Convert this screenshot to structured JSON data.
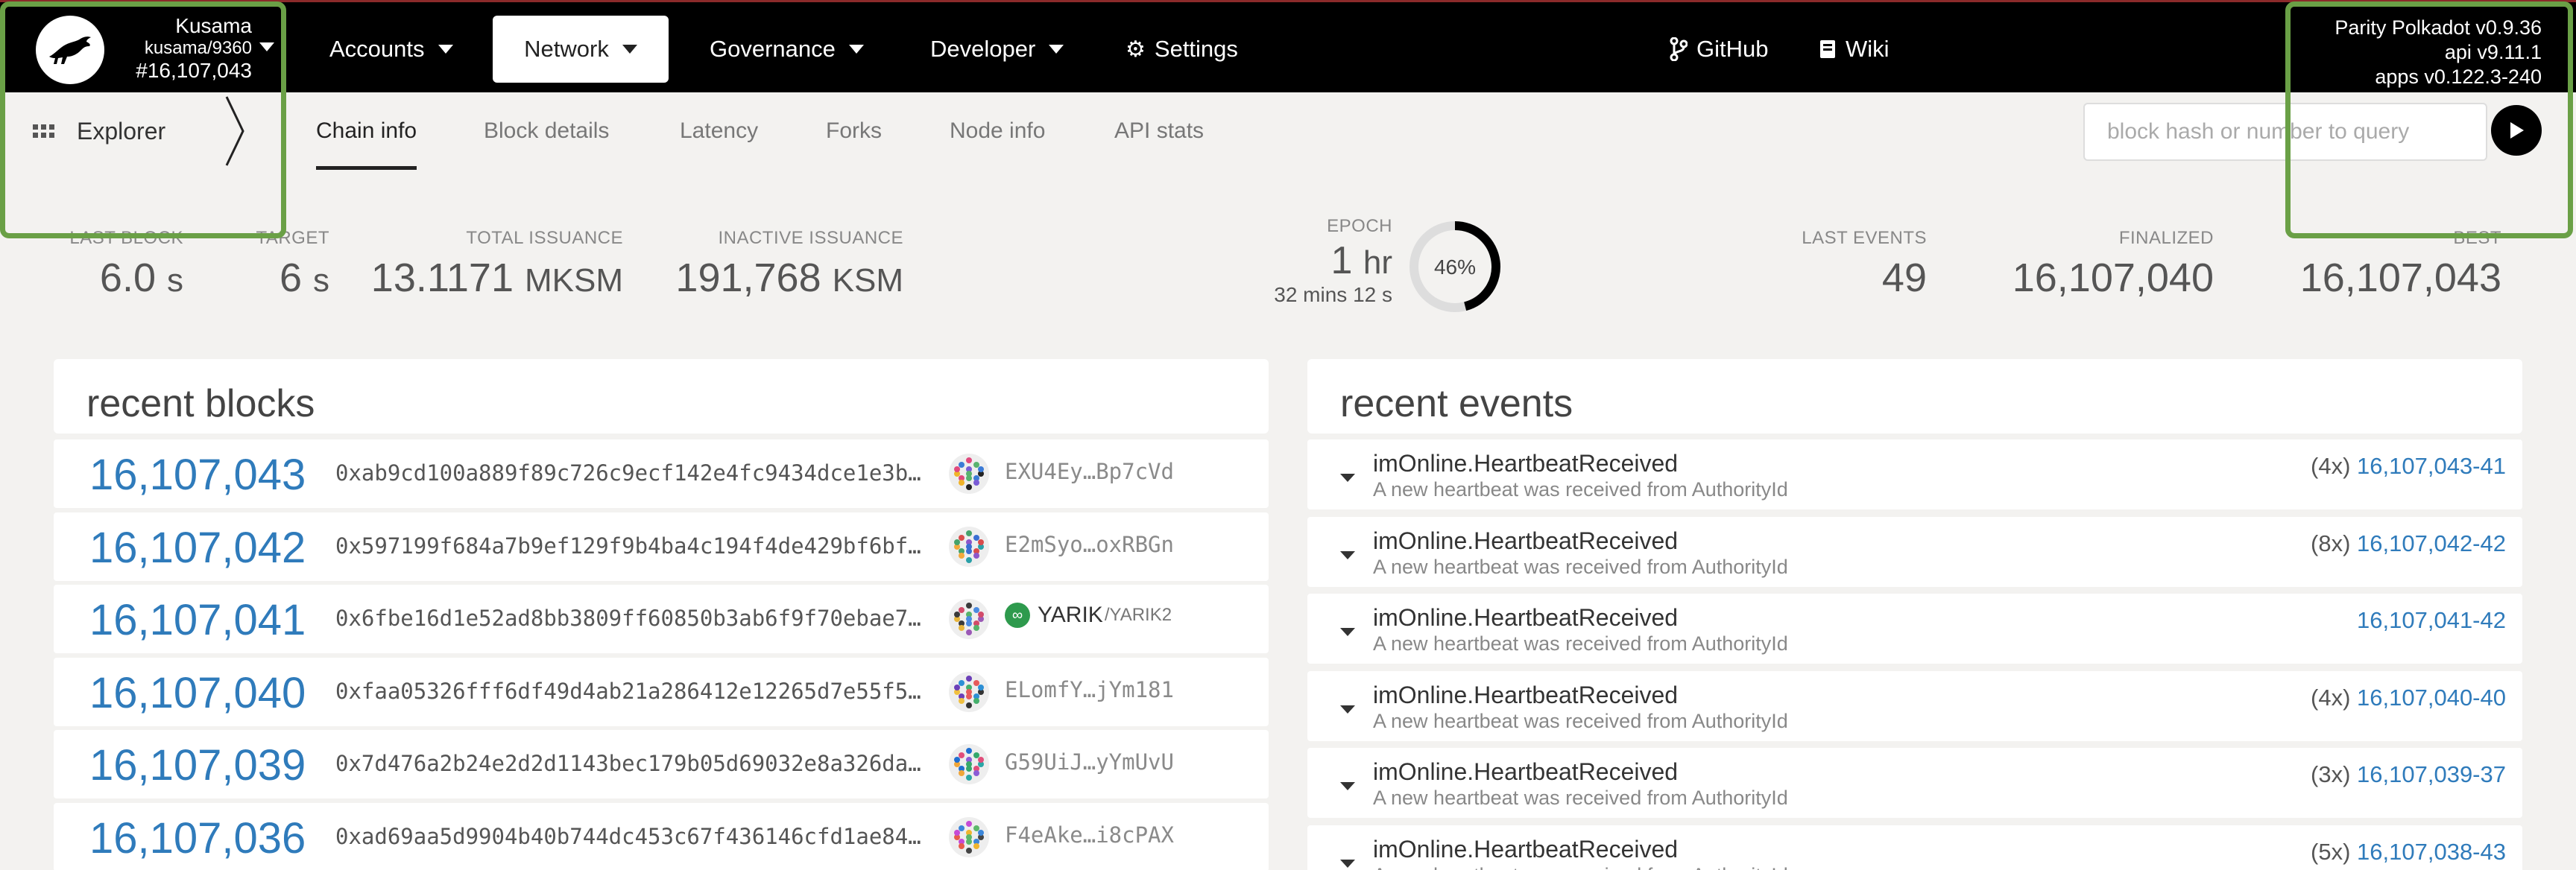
{
  "chain": {
    "name": "Kusama",
    "spec": "kusama/9360",
    "best_block": "#16,107,043"
  },
  "nav": {
    "accounts": "Accounts",
    "network": "Network",
    "governance": "Governance",
    "developer": "Developer",
    "settings": "Settings",
    "github": "GitHub",
    "wiki": "Wiki"
  },
  "version": {
    "node": "Parity Polkadot v0.9.36",
    "api": "api v9.11.1",
    "apps": "apps v0.122.3-240"
  },
  "explorer": {
    "label": "Explorer",
    "tabs": [
      "Chain info",
      "Block details",
      "Latency",
      "Forks",
      "Node info",
      "API stats"
    ]
  },
  "query": {
    "placeholder": "block hash or number to query"
  },
  "stats": {
    "last_block_label": "LAST BLOCK",
    "last_block_value": "6.0",
    "last_block_unit": "s",
    "target_label": "TARGET",
    "target_value": "6",
    "target_unit": "s",
    "total_issuance_label": "TOTAL ISSUANCE",
    "total_issuance_value": "13.1171",
    "total_issuance_unit": "MKSM",
    "inactive_issuance_label": "INACTIVE ISSUANCE",
    "inactive_issuance_value": "191,768",
    "inactive_issuance_unit": "KSM",
    "epoch_label": "EPOCH",
    "epoch_value": "1",
    "epoch_unit": "hr",
    "epoch_sub": "32 mins 12 s",
    "epoch_percent_label": "46%",
    "epoch_progress": 0.46,
    "last_events_label": "LAST EVENTS",
    "last_events_value": "49",
    "finalized_label": "FINALIZED",
    "finalized_value": "16,107,040",
    "best_label": "BEST",
    "best_value": "16,107,043"
  },
  "recent_blocks": {
    "title": "recent blocks",
    "rows": [
      {
        "number": "16,107,043",
        "hash": "0xab9cd100a889f89c726c9ecf142e4fc9434dce1e3b…",
        "author": "EXU4Ey…Bp7cVd"
      },
      {
        "number": "16,107,042",
        "hash": "0x597199f684a7b9ef129f9b4ba4c194f4de429bf6bf…",
        "author": "E2mSyo…oxRBGn"
      },
      {
        "number": "16,107,041",
        "hash": "0x6fbe16d1e52ad8bb3809ff60850b3ab6f9f70ebae7…",
        "author": "YARIK",
        "author_sub": "/YARIK2"
      },
      {
        "number": "16,107,040",
        "hash": "0xfaa05326fff6df49d4ab21a286412e12265d7e55f5…",
        "author": "ELomfY…jYm181"
      },
      {
        "number": "16,107,039",
        "hash": "0x7d476a2b24e2d2d1143bec179b05d69032e8a326da…",
        "author": "G59UiJ…yYmUvU"
      },
      {
        "number": "16,107,036",
        "hash": "0xad69aa5d9904b40b744dc453c67f436146cfd1ae84…",
        "author": "F4eAke…i8cPAX"
      }
    ]
  },
  "recent_events": {
    "title": "recent events",
    "rows": [
      {
        "name": "imOnline.HeartbeatReceived",
        "desc": "A new heartbeat was received from AuthorityId",
        "count": "(4x)",
        "ref": "16,107,043-41"
      },
      {
        "name": "imOnline.HeartbeatReceived",
        "desc": "A new heartbeat was received from AuthorityId",
        "count": "(8x)",
        "ref": "16,107,042-42"
      },
      {
        "name": "imOnline.HeartbeatReceived",
        "desc": "A new heartbeat was received from AuthorityId",
        "count": "",
        "ref": "16,107,041-42"
      },
      {
        "name": "imOnline.HeartbeatReceived",
        "desc": "A new heartbeat was received from AuthorityId",
        "count": "(4x)",
        "ref": "16,107,040-40"
      },
      {
        "name": "imOnline.HeartbeatReceived",
        "desc": "A new heartbeat was received from AuthorityId",
        "count": "(3x)",
        "ref": "16,107,039-37"
      },
      {
        "name": "imOnline.HeartbeatReceived",
        "desc": "A new heartbeat was received from AuthorityId",
        "count": "(5x)",
        "ref": "16,107,038-43"
      }
    ]
  },
  "colors": {
    "accent_link": "#2f7bbb",
    "highlight": "#6aa046",
    "topbar": "#000000"
  }
}
